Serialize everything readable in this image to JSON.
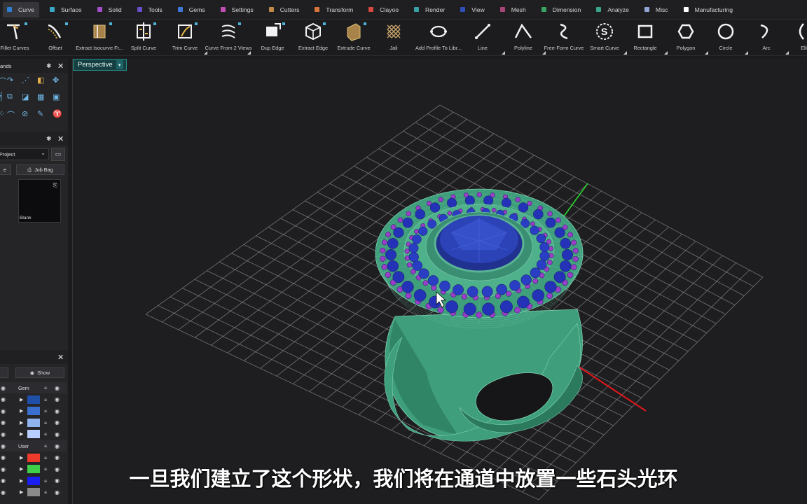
{
  "tabs": [
    {
      "label": "Curve",
      "color": "#2f7fd6",
      "active": true
    },
    {
      "label": "Surface",
      "color": "#3aa7c8"
    },
    {
      "label": "Solid",
      "color": "#a24fc9"
    },
    {
      "label": "Tools",
      "color": "#6750c9"
    },
    {
      "label": "Gems",
      "color": "#3d78d8"
    },
    {
      "label": "Settings",
      "color": "#c24fb3"
    },
    {
      "label": "Cutters",
      "color": "#c28a4a"
    },
    {
      "label": "Transform",
      "color": "#d9743d"
    },
    {
      "label": "Clayoo",
      "color": "#d9493d"
    },
    {
      "label": "Render",
      "color": "#3aa0a8"
    },
    {
      "label": "View",
      "color": "#2f4fb8"
    },
    {
      "label": "Mesh",
      "color": "#a8467a"
    },
    {
      "label": "Dimension",
      "color": "#39a363"
    },
    {
      "label": "Analyze",
      "color": "#3aa58a"
    },
    {
      "label": "Misc",
      "color": "#8fa6d6"
    },
    {
      "label": "Manufacturing",
      "color": "#ffffff"
    }
  ],
  "tools": [
    {
      "label": "Fillet Curves",
      "icon": "fillet-curves-icon"
    },
    {
      "label": "Offset",
      "icon": "offset-icon"
    },
    {
      "label": "Extract Isocurve Fr...",
      "icon": "extract-isocurve-icon"
    },
    {
      "label": "Split Curve",
      "icon": "split-curve-icon"
    },
    {
      "label": "Trim Curve",
      "icon": "trim-curve-icon"
    },
    {
      "label": "Curve From 2 Views",
      "icon": "curve-from-2-views-icon"
    },
    {
      "label": "Dup Edge",
      "icon": "dup-edge-icon"
    },
    {
      "label": "Extract Edge",
      "icon": "extract-edge-icon"
    },
    {
      "label": "Extrude Curve",
      "icon": "extrude-curve-icon"
    },
    {
      "label": "Jali",
      "icon": "jali-icon"
    },
    {
      "label": "Add Profile To Libr...",
      "icon": "add-profile-icon"
    },
    {
      "label": "Line",
      "icon": "line-icon"
    },
    {
      "label": "Polyline",
      "icon": "polyline-icon"
    },
    {
      "label": "Free-Form Curve",
      "icon": "free-form-curve-icon"
    },
    {
      "label": "Smart Curve",
      "icon": "smart-curve-icon"
    },
    {
      "label": "Rectangle",
      "icon": "rectangle-icon"
    },
    {
      "label": "Polygon",
      "icon": "polygon-icon"
    },
    {
      "label": "Circle",
      "icon": "circle-icon"
    },
    {
      "label": "Arc",
      "icon": "arc-icon"
    },
    {
      "label": "Elli",
      "icon": "ellipse-icon"
    }
  ],
  "left_panel": {
    "commands_title": "ands",
    "project_dropdown": "Project",
    "job_bag_button": "Job Bag",
    "left_button": "e",
    "thumbnail_label": "Blank",
    "show_button": "Show",
    "layers": [
      {
        "label": "Gem",
        "color": null,
        "header": true
      },
      {
        "label": "",
        "color": "#1f4fa8"
      },
      {
        "label": "",
        "color": "#3a6fd0"
      },
      {
        "label": "",
        "color": "#8fb4ee"
      },
      {
        "label": "",
        "color": "#b7ceff"
      },
      {
        "label": "User",
        "color": null,
        "header": true
      },
      {
        "label": "",
        "color": "#ee3a2a"
      },
      {
        "label": "",
        "color": "#3fd04a"
      },
      {
        "label": "",
        "color": "#1a1ef0"
      },
      {
        "label": "",
        "color": "#8a8a8a"
      }
    ]
  },
  "viewport": {
    "tab_label": "Perspective",
    "tab_arrow": "▾"
  },
  "subtitle": "一旦我们建立了这个形状，我们将在通道中放置一些石头光环"
}
